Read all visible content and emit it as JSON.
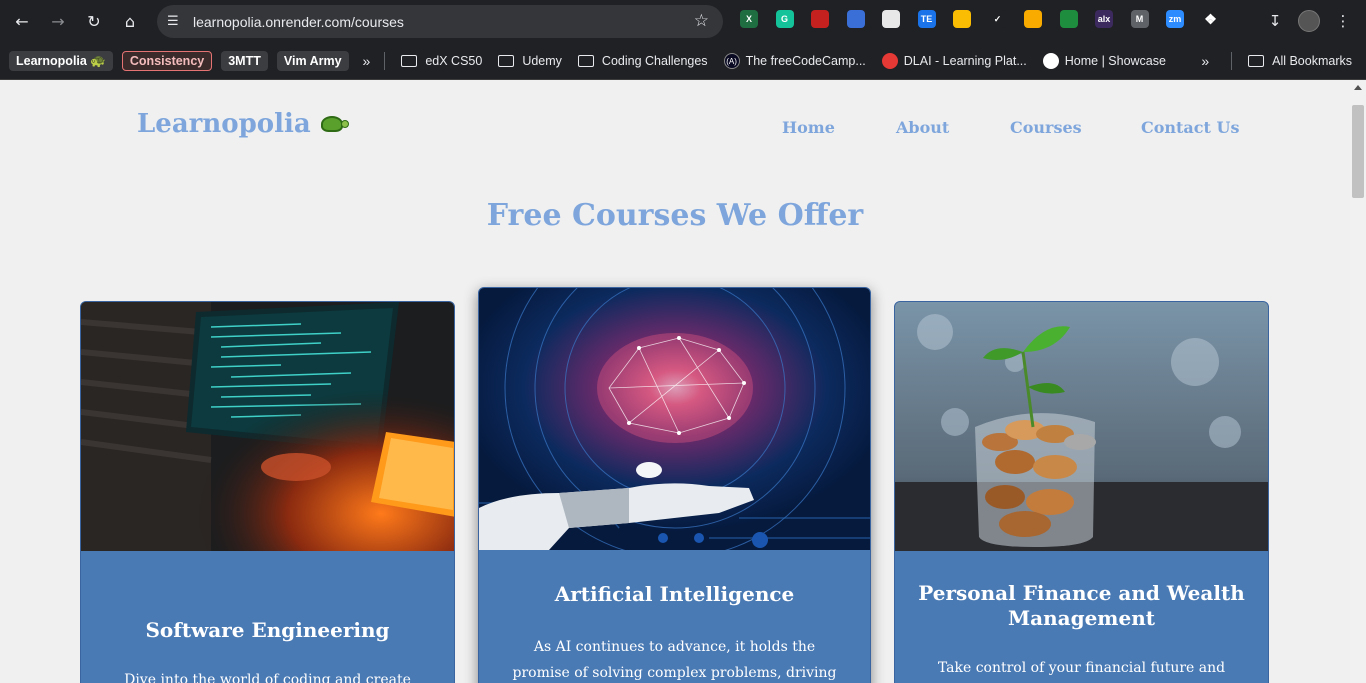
{
  "browser": {
    "url": "learnopolia.onrender.com/courses",
    "extensions": [
      {
        "icon": "excel-icon",
        "label": "X",
        "color": "#1e6e42"
      },
      {
        "icon": "grammarly-icon",
        "label": "G",
        "color": "#15c39a"
      },
      {
        "icon": "calendar-ext-icon",
        "label": "",
        "color": "#c5221f"
      },
      {
        "icon": "colorzilla-icon",
        "label": "",
        "color": "#3b6fd8"
      },
      {
        "icon": "notes-ext-icon",
        "label": "",
        "color": "#e8e8e8"
      },
      {
        "icon": "te-ext-icon",
        "label": "TE",
        "color": "#1a73e8"
      },
      {
        "icon": "keep-ext-icon",
        "label": "",
        "color": "#fbbc04"
      },
      {
        "icon": "check-ext-icon",
        "label": "✓",
        "color": "#202124"
      },
      {
        "icon": "bulb-ext-icon",
        "label": "",
        "color": "#f9ab00"
      },
      {
        "icon": "wave-ext-icon",
        "label": "",
        "color": "#1e8e3e"
      },
      {
        "icon": "alx-ext-icon",
        "label": "alx",
        "color": "#3c2a5e"
      },
      {
        "icon": "m-ext-icon",
        "label": "M",
        "color": "#5f6368"
      },
      {
        "icon": "zoom-ext-icon",
        "label": "zm",
        "color": "#2d8cff"
      }
    ]
  },
  "bookmarks": {
    "chips": [
      "Learnopolia 🐢",
      "Consistency",
      "3MTT",
      "Vim Army"
    ],
    "items": [
      {
        "label": "edX CS50",
        "kind": "folder"
      },
      {
        "label": "Udemy",
        "kind": "folder"
      },
      {
        "label": "Coding Challenges",
        "kind": "folder"
      },
      {
        "label": "The freeCodeCamp...",
        "kind": "site",
        "color": "#0a0a23",
        "glyph": "(A)"
      },
      {
        "label": "DLAI - Learning Plat...",
        "kind": "site",
        "color": "#e53935",
        "glyph": ""
      },
      {
        "label": "Home | Showcase",
        "kind": "site",
        "color": "#ffffff",
        "glyph": ""
      }
    ],
    "all_bookmarks": "All Bookmarks"
  },
  "site": {
    "logo": "Learnopolia",
    "nav": [
      "Home",
      "About",
      "Courses",
      "Contact Us"
    ],
    "title": "Free Courses We Offer"
  },
  "courses": [
    {
      "title": "Software Engineering",
      "description": "Dive into the world of coding and create"
    },
    {
      "title": "Artificial Intelligence",
      "description": "As AI continues to advance, it holds the promise of solving complex problems, driving"
    },
    {
      "title": "Personal Finance and Wealth Management",
      "description": "Take control of your financial future and learn"
    }
  ]
}
